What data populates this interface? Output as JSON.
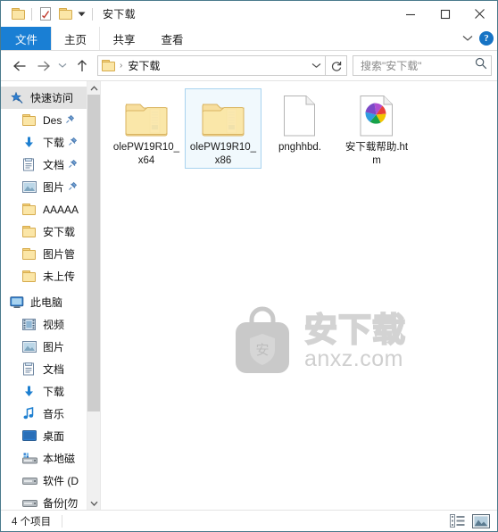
{
  "window": {
    "title": "安下载",
    "controls": {
      "minimize": "minimize",
      "maximize": "maximize",
      "close": "close"
    }
  },
  "quick_access_toolbar": {
    "items": [
      {
        "name": "folder-icon",
        "label": ""
      },
      {
        "name": "properties-icon",
        "label": ""
      },
      {
        "name": "new-folder-icon",
        "label": ""
      }
    ],
    "customize_caret": "▾"
  },
  "ribbon": {
    "tabs": [
      {
        "id": "file",
        "label": "文件",
        "active": true
      },
      {
        "id": "home",
        "label": "主页",
        "active": false
      },
      {
        "id": "share",
        "label": "共享",
        "active": false
      },
      {
        "id": "view",
        "label": "查看",
        "active": false
      }
    ],
    "expand_caret": "⌄",
    "help_label": "?"
  },
  "addressbar": {
    "back": "←",
    "forward": "→",
    "recent": "⌄",
    "up": "↑",
    "breadcrumb": {
      "separator": "›",
      "path": [
        "安下载"
      ]
    },
    "dropdown_caret": "⌄",
    "refresh": "↻"
  },
  "search": {
    "placeholder": "搜索\"安下载\"",
    "icon": "search-icon"
  },
  "sidebar": {
    "groups": [
      {
        "name": "quick-access",
        "root": {
          "label": "快速访问",
          "icon": "star-pin-icon",
          "selected": true
        },
        "items": [
          {
            "label": "Des",
            "icon": "folder-icon",
            "pinned": true
          },
          {
            "label": "下载",
            "icon": "download-icon",
            "pinned": true
          },
          {
            "label": "文档",
            "icon": "documents-icon",
            "pinned": true
          },
          {
            "label": "图片",
            "icon": "pictures-icon",
            "pinned": true
          },
          {
            "label": "AAAAA",
            "icon": "folder-icon",
            "pinned": false
          },
          {
            "label": "安下载",
            "icon": "folder-icon",
            "pinned": false
          },
          {
            "label": "图片管",
            "icon": "folder-icon",
            "pinned": false
          },
          {
            "label": "未上传",
            "icon": "folder-icon",
            "pinned": false
          }
        ]
      },
      {
        "name": "this-pc",
        "root": {
          "label": "此电脑",
          "icon": "computer-icon",
          "selected": false
        },
        "items": [
          {
            "label": "视频",
            "icon": "videos-icon",
            "pinned": false
          },
          {
            "label": "图片",
            "icon": "pictures-icon",
            "pinned": false
          },
          {
            "label": "文档",
            "icon": "documents-icon",
            "pinned": false
          },
          {
            "label": "下载",
            "icon": "download-icon",
            "pinned": false
          },
          {
            "label": "音乐",
            "icon": "music-icon",
            "pinned": false
          },
          {
            "label": "桌面",
            "icon": "desktop-icon",
            "pinned": false
          },
          {
            "label": "本地磁",
            "icon": "local-disk-icon",
            "pinned": false
          },
          {
            "label": "软件 (D",
            "icon": "drive-icon",
            "pinned": false
          },
          {
            "label": "备份[勿",
            "icon": "drive-icon",
            "pinned": false
          }
        ]
      }
    ],
    "scrollbar": {
      "up": "⌃",
      "down": "⌄"
    }
  },
  "files": [
    {
      "name": "olePW19R10_x64",
      "type": "folder",
      "selected": false
    },
    {
      "name": "olePW19R10_x86",
      "type": "folder",
      "selected": true
    },
    {
      "name": "pnghhbd.",
      "type": "file",
      "selected": false
    },
    {
      "name": "安下载帮助.htm",
      "type": "html",
      "selected": false
    }
  ],
  "watermark": {
    "cn": "安下载",
    "en": "anxz.com",
    "icon": "anxz-bag-logo"
  },
  "statusbar": {
    "item_count": "4 个项目",
    "views": [
      {
        "name": "details-view-button",
        "active": false
      },
      {
        "name": "large-icons-view-button",
        "active": true
      }
    ]
  },
  "colors": {
    "accent": "#1a7fd4",
    "window_border": "#4a7a8c",
    "folder_fill": "#fbe6a7",
    "folder_edge": "#d6ab4c",
    "selection_border": "#a8d3ef",
    "watermark_gray": "#d3d3d3"
  }
}
